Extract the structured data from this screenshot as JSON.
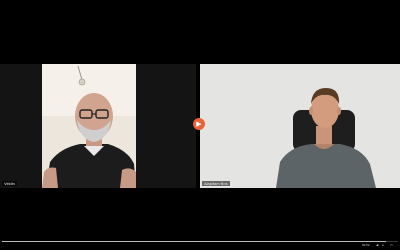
{
  "participants": [
    {
      "name": "Veldin"
    },
    {
      "name": "Alapifam Bos"
    }
  ],
  "controls": {
    "progress": 0.97,
    "time": "00:52",
    "accent_color": "#e8623a",
    "swap_icon": "play-circle-icon",
    "icons": [
      "volume-icon",
      "settings-icon",
      "fullscreen-icon"
    ]
  }
}
